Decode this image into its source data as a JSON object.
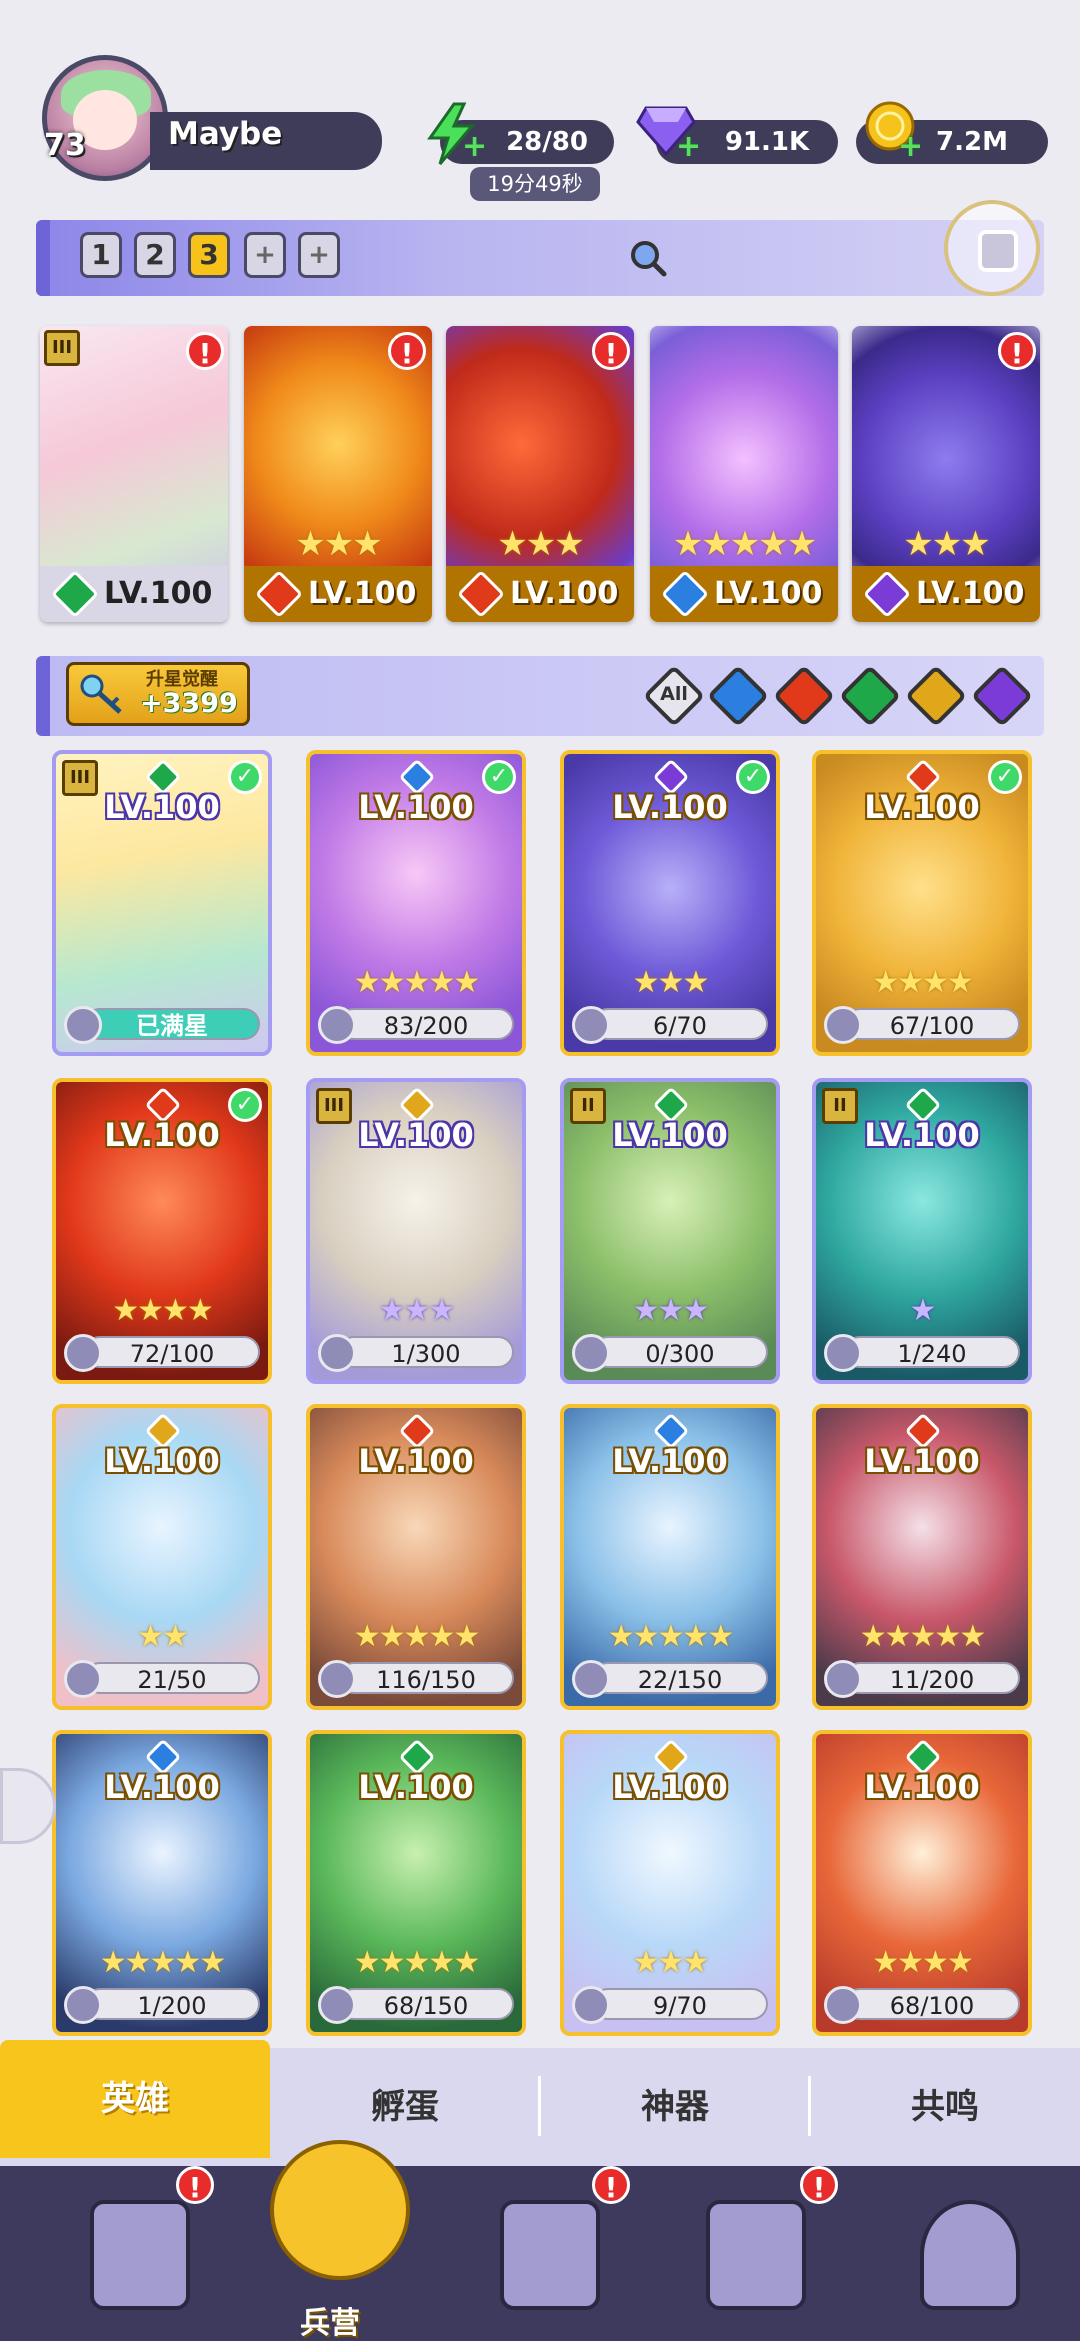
{
  "player": {
    "level": "73",
    "name": "Maybe"
  },
  "resources": {
    "energy": "28/80",
    "energy_timer": "19分49秒",
    "gems": "91.1K",
    "coins": "7.2M"
  },
  "team_tabs": [
    "1",
    "2",
    "3",
    "+",
    "+"
  ],
  "team": [
    {
      "level": "LV.100",
      "element": "green",
      "stars": "",
      "alert": "!",
      "rank": "III"
    },
    {
      "level": "LV.100",
      "element": "red",
      "stars": "★★★",
      "alert": "!"
    },
    {
      "level": "LV.100",
      "element": "red",
      "stars": "★★★",
      "alert": "!"
    },
    {
      "level": "LV.100",
      "element": "blue",
      "stars": "★★★★★",
      "alert": ""
    },
    {
      "level": "LV.100",
      "element": "purple",
      "stars": "★★★",
      "alert": "!"
    }
  ],
  "awaken": {
    "title": "升星觉醒",
    "value": "+3399"
  },
  "filters": {
    "all_label": "All",
    "elements": [
      "blue",
      "red",
      "green",
      "gold",
      "purple"
    ]
  },
  "heroes": [
    {
      "level": "LV.100",
      "progress": "已满星",
      "full": true,
      "element": "green",
      "checked": true,
      "rank": "III",
      "stars": "",
      "style": "purple"
    },
    {
      "level": "LV.100",
      "progress": "83/200",
      "element": "blue",
      "checked": true,
      "stars": "★★★★★",
      "style": "gold"
    },
    {
      "level": "LV.100",
      "progress": "6/70",
      "element": "purple",
      "checked": true,
      "stars": "★★★",
      "style": "gold"
    },
    {
      "level": "LV.100",
      "progress": "67/100",
      "element": "red",
      "checked": true,
      "stars": "★★★★",
      "style": "gold"
    },
    {
      "level": "LV.100",
      "progress": "72/100",
      "element": "red",
      "checked": true,
      "stars": "★★★★",
      "style": "gold"
    },
    {
      "level": "LV.100",
      "progress": "1/300",
      "element": "gold",
      "checked": false,
      "rank": "III",
      "stars": "★★★",
      "starstyle": "purple",
      "style": "purple"
    },
    {
      "level": "LV.100",
      "progress": "0/300",
      "element": "green",
      "checked": false,
      "rank": "II",
      "stars": "★★★",
      "starstyle": "purple",
      "style": "purple"
    },
    {
      "level": "LV.100",
      "progress": "1/240",
      "element": "green",
      "checked": false,
      "rank": "II",
      "stars": "★",
      "starstyle": "purple",
      "style": "purple"
    },
    {
      "level": "LV.100",
      "progress": "21/50",
      "element": "gold",
      "checked": false,
      "stars": "★★",
      "style": "gold"
    },
    {
      "level": "LV.100",
      "progress": "116/150",
      "element": "red",
      "checked": false,
      "stars": "★★★★★",
      "style": "gold"
    },
    {
      "level": "LV.100",
      "progress": "22/150",
      "element": "blue",
      "checked": false,
      "stars": "★★★★★",
      "style": "gold"
    },
    {
      "level": "LV.100",
      "progress": "11/200",
      "element": "red",
      "checked": false,
      "stars": "★★★★★",
      "style": "gold"
    },
    {
      "level": "LV.100",
      "progress": "1/200",
      "element": "blue",
      "checked": false,
      "stars": "★★★★★",
      "style": "gold"
    },
    {
      "level": "LV.100",
      "progress": "68/150",
      "element": "green",
      "checked": false,
      "stars": "★★★★★",
      "style": "gold"
    },
    {
      "level": "LV.100",
      "progress": "9/70",
      "element": "gold",
      "checked": false,
      "stars": "★★★",
      "style": "gold"
    },
    {
      "level": "LV.100",
      "progress": "68/100",
      "element": "green",
      "checked": false,
      "stars": "★★★★",
      "style": "gold"
    }
  ],
  "tabs": [
    "英雄",
    "孵蛋",
    "神器",
    "共鸣"
  ],
  "nav": {
    "active_label": "兵营",
    "alerts": [
      "!",
      "!",
      "!"
    ]
  },
  "colors": {
    "green": "#1fa84a",
    "red": "#e03a1a",
    "blue": "#2a7fe0",
    "purple": "#7b3bd6",
    "gold": "#e0a71a"
  }
}
